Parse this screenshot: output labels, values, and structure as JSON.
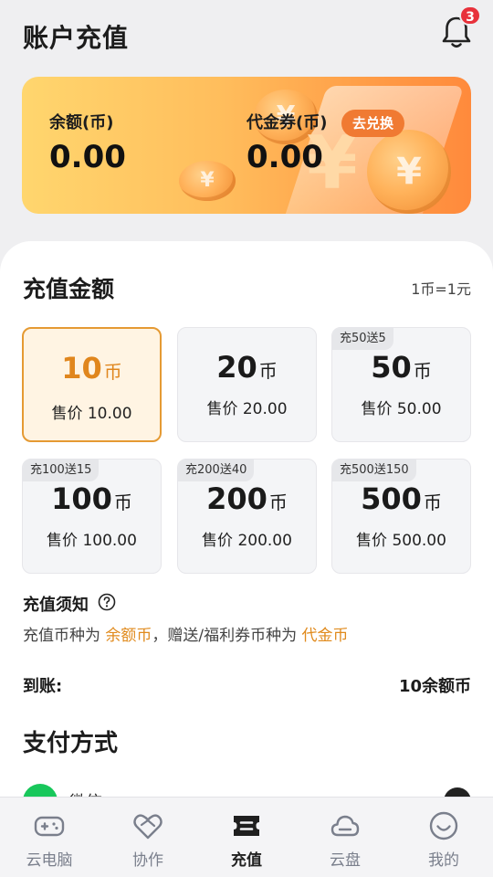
{
  "header": {
    "title": "账户充值",
    "notification_count": "3"
  },
  "balance_card": {
    "balance_label": "余额(币)",
    "balance_value": "0.00",
    "voucher_label": "代金券(币)",
    "voucher_value": "0.00",
    "exchange_button": "去兑换"
  },
  "recharge": {
    "title": "充值金额",
    "rate": "1币=1元",
    "unit": "币",
    "options": [
      {
        "tag": "",
        "amount": "10",
        "price": "售价 10.00",
        "selected": true
      },
      {
        "tag": "",
        "amount": "20",
        "price": "售价 20.00",
        "selected": false
      },
      {
        "tag": "充50送5",
        "amount": "50",
        "price": "售价 50.00",
        "selected": false
      },
      {
        "tag": "充100送15",
        "amount": "100",
        "price": "售价 100.00",
        "selected": false
      },
      {
        "tag": "充200送40",
        "amount": "200",
        "price": "售价 200.00",
        "selected": false
      },
      {
        "tag": "充500送150",
        "amount": "500",
        "price": "售价 500.00",
        "selected": false
      }
    ]
  },
  "notice": {
    "title": "充值须知",
    "text_part1": "充值币种为 ",
    "highlight1": "余额币",
    "text_part2": "，赠送/福利券币种为 ",
    "highlight2": "代金币"
  },
  "arrival": {
    "label": "到账:",
    "value": "10余额币"
  },
  "payment": {
    "title": "支付方式",
    "methods": [
      {
        "label": "微信"
      }
    ]
  },
  "tabbar": {
    "tabs": [
      {
        "label": "云电脑",
        "icon": "gamepad-icon",
        "active": false
      },
      {
        "label": "协作",
        "icon": "heart-handshake-icon",
        "active": false
      },
      {
        "label": "充值",
        "icon": "ticket-icon",
        "active": true
      },
      {
        "label": "云盘",
        "icon": "cloud-icon",
        "active": false
      },
      {
        "label": "我的",
        "icon": "smiley-icon",
        "active": false
      }
    ]
  },
  "colors": {
    "accent": "#e59a33",
    "highlight_text": "#e08a1c",
    "badge": "#e8313b",
    "wechat": "#18c75b"
  }
}
